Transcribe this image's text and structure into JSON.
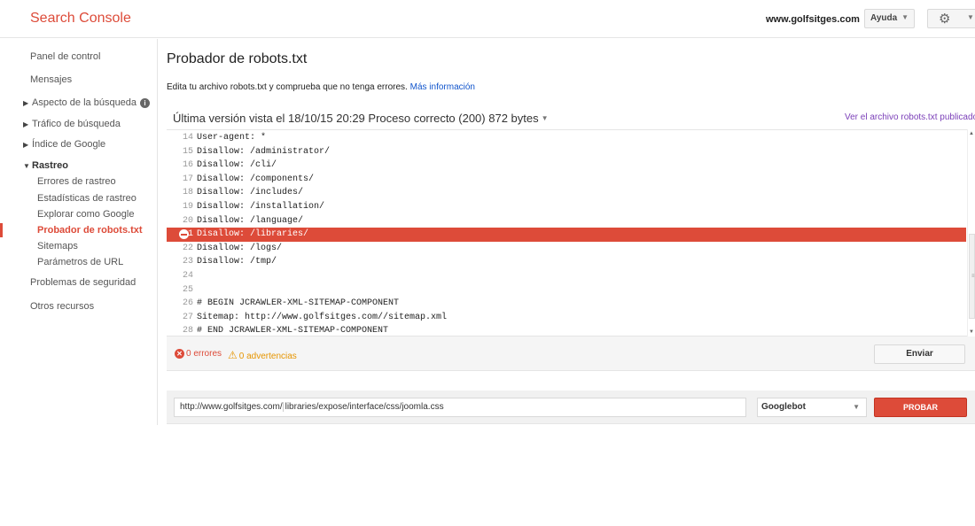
{
  "header": {
    "brand": "Search Console",
    "site": "www.golfsitges.com",
    "help_label": "Ayuda"
  },
  "sidebar": {
    "items": [
      {
        "label": "Panel de control"
      },
      {
        "label": "Mensajes"
      },
      {
        "label": "Aspecto de la búsqueda"
      },
      {
        "label": "Tráfico de búsqueda"
      },
      {
        "label": "Índice de Google"
      },
      {
        "label": "Rastreo"
      },
      {
        "label": "Errores de rastreo"
      },
      {
        "label": "Estadísticas de rastreo"
      },
      {
        "label": "Explorar como Google"
      },
      {
        "label": "Probador de robots.txt"
      },
      {
        "label": "Sitemaps"
      },
      {
        "label": "Parámetros de URL"
      },
      {
        "label": "Problemas de seguridad"
      },
      {
        "label": "Otros recursos"
      }
    ]
  },
  "main": {
    "title": "Probador de robots.txt",
    "description": "Edita tu archivo robots.txt y comprueba que no tenga errores.",
    "more_info": "Más información",
    "version": "Última versión vista el 18/10/15 20:29 Proceso correcto (200) 872 bytes",
    "view_link": "Ver el archivo robots.txt publicado"
  },
  "editor": {
    "lines": [
      {
        "num": "14",
        "text": "User-agent: *"
      },
      {
        "num": "15",
        "text": "Disallow: /administrator/"
      },
      {
        "num": "16",
        "text": "Disallow: /cli/"
      },
      {
        "num": "17",
        "text": "Disallow: /components/"
      },
      {
        "num": "18",
        "text": "Disallow: /includes/"
      },
      {
        "num": "19",
        "text": "Disallow: /installation/"
      },
      {
        "num": "20",
        "text": "Disallow: /language/"
      },
      {
        "num": "1",
        "text": "Disallow: /libraries/"
      },
      {
        "num": "22",
        "text": "Disallow: /logs/"
      },
      {
        "num": "23",
        "text": "Disallow: /tmp/"
      },
      {
        "num": "24",
        "text": ""
      },
      {
        "num": "25",
        "text": ""
      },
      {
        "num": "26",
        "text": "# BEGIN JCRAWLER-XML-SITEMAP-COMPONENT"
      },
      {
        "num": "27",
        "text": "Sitemap: http://www.golfsitges.com//sitemap.xml"
      },
      {
        "num": "28",
        "text": "# END JCRAWLER-XML-SITEMAP-COMPONENT"
      }
    ]
  },
  "status": {
    "errors": "0 errores",
    "warnings": "0 advertencias",
    "send_label": "Enviar"
  },
  "test": {
    "url_prefix": "http://www.golfsitges.com/",
    "url_path": "libraries/expose/interface/css/joomla.css",
    "agent": "Googlebot",
    "button_label": "PROBAR"
  },
  "colors": {
    "accent": "#dd4b39",
    "link": "#1155cc",
    "warning": "#e69500"
  }
}
